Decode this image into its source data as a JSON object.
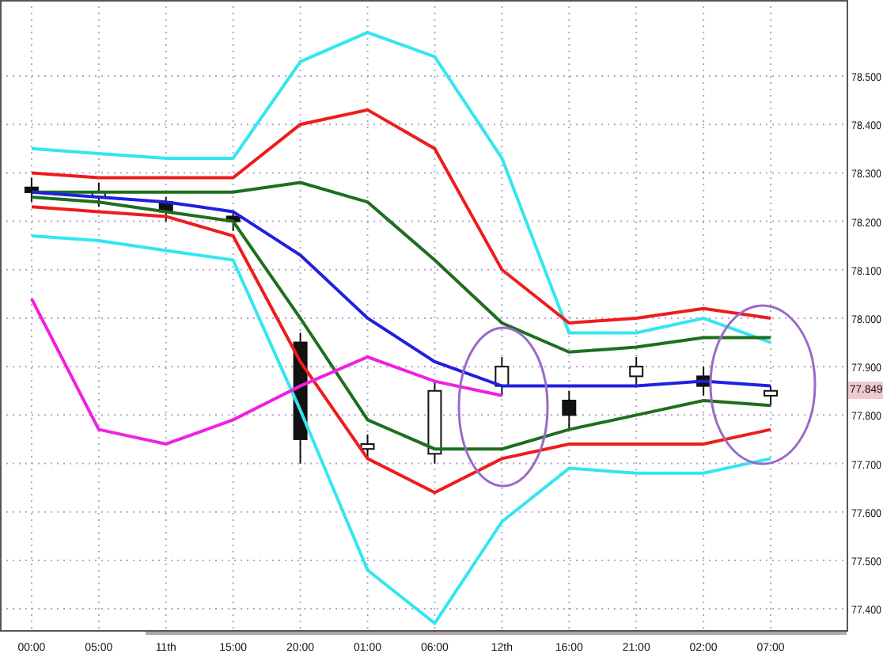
{
  "price_chart": {
    "chart_data": {
      "type": "candlestick",
      "categories": [
        "00:00",
        "05:00",
        "11th",
        "15:00",
        "20:00",
        "01:00",
        "06:00",
        "12th",
        "16:00",
        "21:00",
        "02:00",
        "07:00"
      ],
      "ylim": [
        77.356,
        78.657
      ],
      "grid": true,
      "yticks": [
        {
          "value": 78.5,
          "label": "78.500"
        },
        {
          "value": 78.4,
          "label": "78.400"
        },
        {
          "value": 78.3,
          "label": "78.300"
        },
        {
          "value": 78.2,
          "label": "78.200"
        },
        {
          "value": 78.1,
          "label": "78.100"
        },
        {
          "value": 78.0,
          "label": "78.000"
        },
        {
          "value": 77.9,
          "label": "77.900"
        },
        {
          "value": 77.8,
          "label": "77.800"
        },
        {
          "value": 77.7,
          "label": "77.700"
        },
        {
          "value": 77.6,
          "label": "77.600"
        },
        {
          "value": 77.5,
          "label": "77.500"
        },
        {
          "value": 77.4,
          "label": "77.400"
        }
      ],
      "ohlc": [
        [
          78.27,
          78.29,
          78.24,
          78.26
        ],
        [
          78.25,
          78.28,
          78.23,
          78.26
        ],
        [
          78.24,
          78.25,
          78.2,
          78.22
        ],
        [
          78.21,
          78.22,
          78.18,
          78.2
        ],
        [
          77.95,
          77.97,
          77.7,
          77.75
        ],
        [
          77.73,
          77.76,
          77.71,
          77.74
        ],
        [
          77.72,
          77.87,
          77.7,
          77.85
        ],
        [
          77.86,
          77.92,
          77.84,
          77.9
        ],
        [
          77.83,
          77.85,
          77.77,
          77.8
        ],
        [
          77.88,
          77.92,
          77.86,
          77.9
        ],
        [
          77.88,
          77.9,
          77.84,
          77.86
        ],
        [
          77.84,
          77.86,
          77.82,
          77.85
        ]
      ]
    }
  },
  "indicators": {
    "chart_data": {
      "type": "line",
      "ylim": [
        77.356,
        78.657
      ],
      "series": [
        {
          "color": "#33e6f0",
          "values": [
            78.35,
            78.34,
            78.33,
            78.33,
            78.53,
            78.59,
            78.54,
            78.33,
            77.97,
            77.97,
            78.0,
            77.95
          ]
        },
        {
          "color": "#ee1c1c",
          "values": [
            78.3,
            78.29,
            78.29,
            78.29,
            78.4,
            78.43,
            78.35,
            78.1,
            77.99,
            78.0,
            78.02,
            78.0
          ]
        },
        {
          "color": "#1e6e1e",
          "values": [
            78.26,
            78.26,
            78.26,
            78.26,
            78.28,
            78.24,
            78.12,
            77.99,
            77.93,
            77.94,
            77.96,
            77.96
          ]
        },
        {
          "color": "#2020e0",
          "values": [
            78.26,
            78.25,
            78.24,
            78.22,
            78.13,
            78.0,
            77.91,
            77.86,
            77.86,
            77.86,
            77.87,
            77.86
          ]
        },
        {
          "color": "#1e6e1e",
          "values": [
            78.25,
            78.24,
            78.22,
            78.2,
            78.0,
            77.79,
            77.73,
            77.73,
            77.77,
            77.8,
            77.83,
            77.82
          ]
        },
        {
          "color": "#ee1c1c",
          "values": [
            78.23,
            78.22,
            78.21,
            78.17,
            77.91,
            77.71,
            77.64,
            77.71,
            77.74,
            77.74,
            77.74,
            77.77
          ]
        },
        {
          "color": "#33e6f0",
          "values": [
            78.17,
            78.16,
            78.14,
            78.12,
            77.81,
            77.48,
            77.37,
            77.58,
            77.69,
            77.68,
            77.68,
            77.71
          ]
        },
        {
          "color": "#f020e0",
          "values": [
            78.04,
            77.77,
            77.74,
            77.79,
            77.86,
            77.92,
            77.87,
            77.84,
            null,
            null,
            null,
            null
          ]
        }
      ]
    }
  },
  "last_price": "77.849"
}
